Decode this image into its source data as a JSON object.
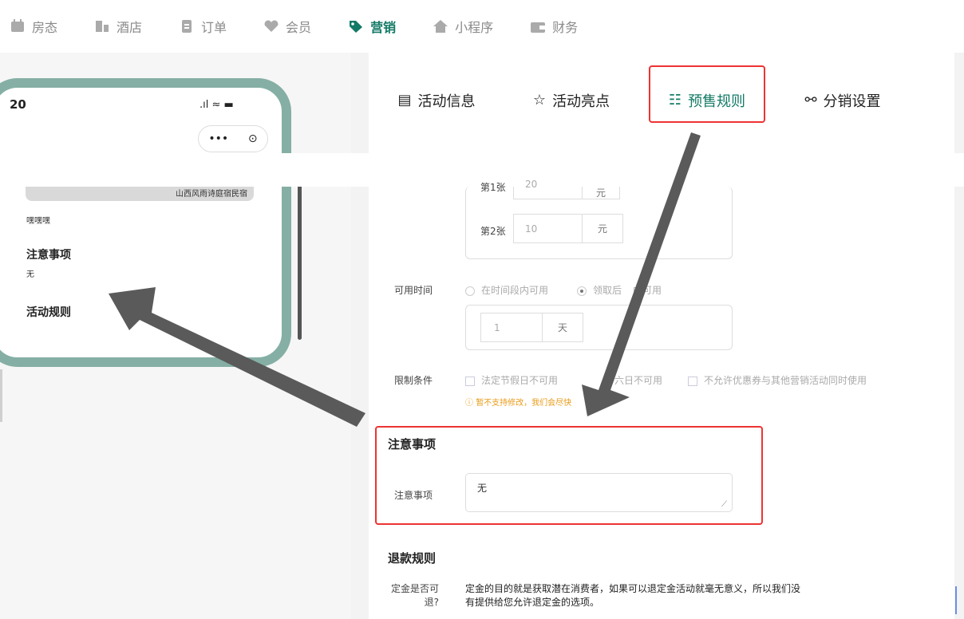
{
  "nav": {
    "items": [
      {
        "label": "房态",
        "icon": "calendar-icon"
      },
      {
        "label": "酒店",
        "icon": "building-icon"
      },
      {
        "label": "订单",
        "icon": "order-icon"
      },
      {
        "label": "会员",
        "icon": "heart-icon"
      },
      {
        "label": "营销",
        "icon": "tag-icon",
        "active": true
      },
      {
        "label": "小程序",
        "icon": "house-icon"
      },
      {
        "label": "财务",
        "icon": "wallet-icon"
      }
    ],
    "active_color": "#137a66"
  },
  "phone": {
    "time": "20",
    "status_icons": ".ıl ≈ ▬",
    "capsule_more": "•••",
    "capsule_close": "⊙",
    "image_caption": "山西风雨诗庭宿民宿",
    "desc": "嘿嘿嘿",
    "notice_title": "注意事项",
    "notice_value": "无",
    "rules_title": "活动规则"
  },
  "tabs": {
    "info": "活动信息",
    "highlight": "活动亮点",
    "presale": "预售规则",
    "distribution": "分销设置"
  },
  "form": {
    "ticket_1": {
      "label": "第1张",
      "value": "20",
      "unit": "元"
    },
    "ticket_2": {
      "label": "第2张",
      "value": "10",
      "unit": "元"
    },
    "available_time": {
      "label": "可用时间",
      "option_1": "在时间段内可用",
      "option_2": "领取后",
      "option_2_suffix": "内可用",
      "days_value": "1",
      "days_unit": "天"
    },
    "restrictions": {
      "label": "限制条件",
      "option_1": "法定节假日不可用",
      "option_2": "六日不可用",
      "option_3": "不允许优惠券与其他营销活动同时使用",
      "warning": "暂不支持修改，我们会尽快"
    },
    "notice": {
      "section_title": "注意事项",
      "label": "注意事项",
      "value": "无"
    },
    "refund": {
      "section_title": "退款规则",
      "question": "定金是否可退?",
      "answer": "定金的目的就是获取潜在消费者，如果可以退定金活动就毫无意义，所以我们没有提供给您允许退定金的选项。"
    }
  },
  "colors": {
    "highlight_red": "#e33333",
    "warning": "#e89b18",
    "arrow": "#5a5a5a"
  }
}
